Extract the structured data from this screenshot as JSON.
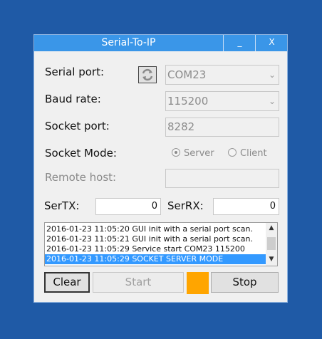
{
  "window": {
    "title": "Serial-To-IP",
    "minimize_label": "_",
    "close_label": "X"
  },
  "form": {
    "serial_port_label": "Serial port:",
    "serial_port_value": "COM23",
    "baud_rate_label": "Baud rate:",
    "baud_rate_value": "115200",
    "socket_port_label": "Socket port:",
    "socket_port_value": "8282",
    "socket_mode_label": "Socket Mode:",
    "mode_server_label": "Server",
    "mode_client_label": "Client",
    "mode_selected": "Server",
    "remote_host_label": "Remote host:",
    "remote_host_value": ""
  },
  "counters": {
    "sertx_label": "SerTX:",
    "sertx_value": "0",
    "serrx_label": "SerRX:",
    "serrx_value": "0"
  },
  "log": [
    "2016-01-23 11:05:20 GUI init with a serial port scan.",
    "2016-01-23 11:05:21 GUI init with a serial port scan.",
    "2016-01-23 11:05:29 Service start COM23 115200",
    "2016-01-23 11:05:29 SOCKET SERVER MODE"
  ],
  "buttons": {
    "clear_label": "Clear",
    "start_label": "Start",
    "stop_label": "Stop"
  },
  "icons": {
    "refresh": "refresh-icon",
    "status": "status-indicator"
  },
  "colors": {
    "desktop": "#1f5aa6",
    "titlebar": "#3a96e8",
    "status_indicator": "#ffa500",
    "selection": "#3399ff"
  }
}
